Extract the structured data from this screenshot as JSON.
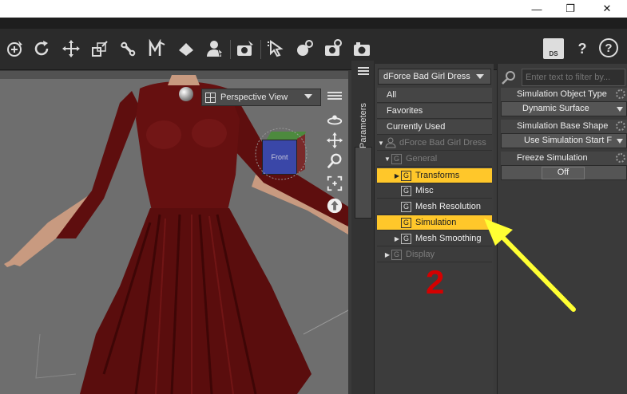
{
  "window": {
    "minimize_glyph": "—",
    "maximize_glyph": "❐",
    "close_glyph": "✕"
  },
  "toolbar": {
    "tools": [
      {
        "icon": "universal-tool-icon"
      },
      {
        "icon": "rotate-tool-icon"
      },
      {
        "icon": "translate-tool-icon"
      },
      {
        "icon": "scale-tool-icon"
      },
      {
        "icon": "joint-editor-icon"
      },
      {
        "icon": "morph-icon"
      },
      {
        "icon": "surface-selection-icon"
      },
      {
        "icon": "figure-selection-icon"
      },
      {
        "icon": "camera-render-icon"
      },
      {
        "icon": "node-selection-icon"
      },
      {
        "icon": "render-settings-icon"
      },
      {
        "icon": "render-icon"
      },
      {
        "icon": "spot-render-icon"
      }
    ],
    "right": {
      "ds_label": "DS",
      "help_glyph": "?",
      "info_glyph": "?"
    }
  },
  "viewport": {
    "view_label": "Perspective View",
    "cube_label": "Front"
  },
  "sidetab": {
    "label": "Parameters"
  },
  "tree": {
    "figure_select": "dForce Bad Girl Dress",
    "items": [
      {
        "label": "All"
      },
      {
        "label": "Favorites"
      },
      {
        "label": "Currently Used"
      },
      {
        "label": "dForce Bad Girl Dress"
      },
      {
        "label": "General"
      },
      {
        "label": "Transforms"
      },
      {
        "label": "Misc"
      },
      {
        "label": "Mesh Resolution"
      },
      {
        "label": "Simulation"
      },
      {
        "label": "Mesh Smoothing"
      },
      {
        "label": "Display"
      }
    ],
    "group_glyph": "G"
  },
  "props": {
    "filter_placeholder": "Enter text to filter by...",
    "params": [
      {
        "label": "Simulation Object Type",
        "value": "Dynamic Surface"
      },
      {
        "label": "Simulation Base Shape",
        "value": "Use Simulation Start F"
      },
      {
        "label": "Freeze Simulation",
        "value": "Off"
      }
    ]
  },
  "annotation": {
    "step_number": "2",
    "arrow_color": "#ffff33"
  },
  "colors": {
    "highlight": "#ffc72a",
    "annotation_number": "#d40000",
    "dress": "#5a0d0d"
  }
}
